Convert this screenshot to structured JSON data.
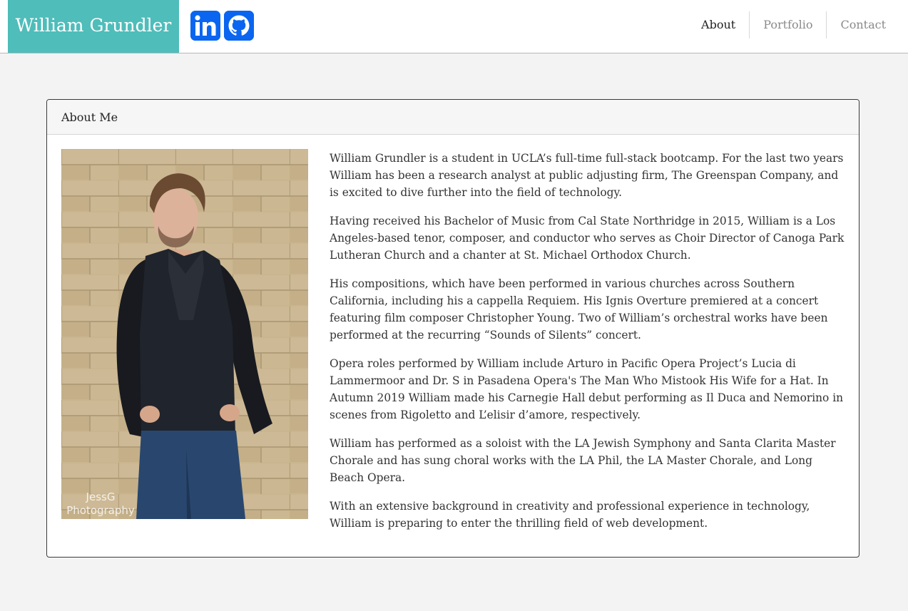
{
  "nav": {
    "brand": "William Grundler",
    "links": [
      "About",
      "Portfolio",
      "Contact"
    ],
    "social_icons": [
      "linkedin-icon",
      "github-icon"
    ]
  },
  "about": {
    "title": "About Me",
    "photo_watermark": [
      "JessG",
      "Photography"
    ],
    "paragraphs": [
      "William Grundler is a student in UCLA’s full-time full-stack bootcamp. For the last two years William has been a research analyst at public adjusting firm, The Greenspan Company, and is excited to dive further into the field of technology.",
      "Having received his Bachelor of Music from Cal State Northridge in 2015, William is a Los Angeles-based tenor, composer, and conductor who serves as Choir Director of Canoga Park Lutheran Church and a chanter at St. Michael Orthodox Church.",
      "His compositions, which have been performed in various churches across Southern California, including his a cappella Requiem. His Ignis Overture premiered at a concert featuring film composer Christopher Young. Two of William’s orchestral works have been performed at the recurring “Sounds of Silents” concert.",
      "Opera roles performed by William include Arturo in Pacific Opera Project’s Lucia di Lammermoor and Dr. S in Pasadena Opera's The Man Who Mistook His Wife for a Hat. In Autumn 2019 William made his Carnegie Hall debut performing as Il Duca and Nemorino in scenes from Rigoletto and L’elisir d’amore, respectively.",
      "William has performed as a soloist with the LA Jewish Symphony and Santa Clarita Master Chorale and has sung choral works with the LA Phil, the LA Master Chorale, and Long Beach Opera.",
      "With an extensive background in creativity and professional experience in technology, William is preparing to enter the thrilling field of web development."
    ]
  },
  "colors": {
    "brand_bg": "#4fbdba",
    "social_bg": "#0a66f0",
    "page_bg": "#f3f3f3"
  }
}
